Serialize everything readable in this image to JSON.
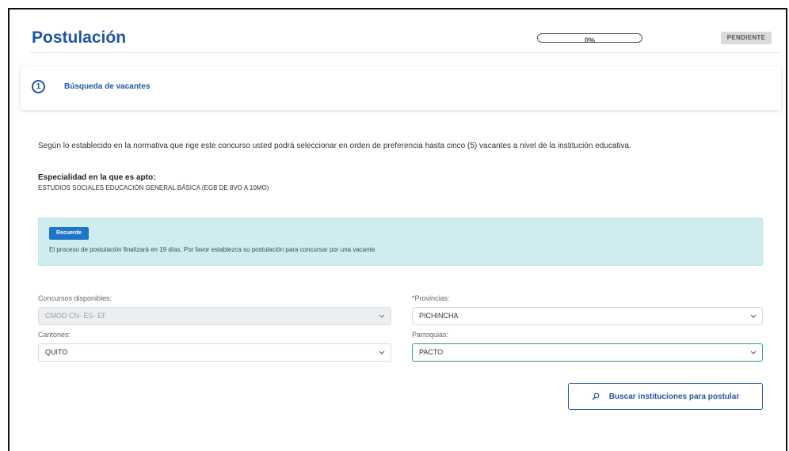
{
  "page": {
    "title": "Postulación",
    "progress": {
      "percent_text": "0%",
      "value": 0
    },
    "status_badge": "PENDIENTE"
  },
  "step": {
    "number": "1",
    "title": "Búsqueda de vacantes"
  },
  "intro": {
    "text": "Según lo establecido en la normativa que rige este concurso usted podrá seleccionar en orden de preferencia hasta cinco (5) vacantes a nivel de la institución educativa."
  },
  "specialty": {
    "label": "Especialidad en la que es apto:",
    "value": "ESTUDIOS SOCIALES EDUCACIÓN GENERAL BÁSICA (EGB DE 8VO A 10MO)"
  },
  "alert": {
    "badge": "Recuerde",
    "text": "El proceso de postulación finalizará en 19 días. Por favor establezca su postulación para concursar por una vacante."
  },
  "filters": {
    "concursos": {
      "label": "Concursos disponibles:",
      "value": "CMOD CN- ES- EF"
    },
    "provincias": {
      "label": "*Provincias:",
      "value": "PICHINCHA"
    },
    "cantones": {
      "label": "Cantones:",
      "value": "QUITO"
    },
    "parroquias": {
      "label": "Parroquias:",
      "value": "PACTO"
    }
  },
  "actions": {
    "search_button": "Buscar instituciones para postular"
  },
  "icons": {
    "search": "search-icon",
    "chevron": "chevron-down-icon"
  },
  "colors": {
    "brand_blue": "#1f56a8",
    "badge_blue": "#1f75c7",
    "alert_bg": "#d1ecf1",
    "active_border": "#28a388",
    "pending_bg": "#d9dadc"
  }
}
